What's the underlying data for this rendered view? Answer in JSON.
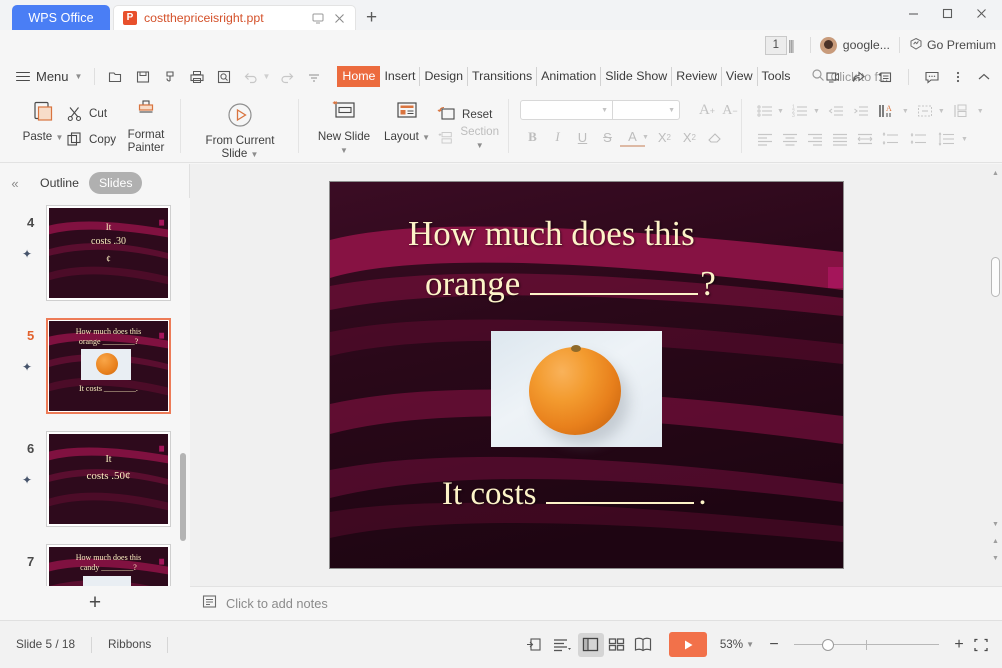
{
  "window": {
    "wps_button": "WPS Office",
    "document_tab": {
      "title": "costthepriceisright.ppt",
      "icon": "P",
      "present_icon": "monitor-icon",
      "close_icon": "close-icon"
    },
    "new_tab": "+",
    "minimize": "—",
    "maximize": "□",
    "close": "✕",
    "doc_count_badge": "1",
    "account_name": "google...",
    "premium_label": "Go Premium"
  },
  "menubar": {
    "menu_label": "Menu",
    "quick_access": [
      "open-icon",
      "save-icon",
      "save-as-icon",
      "print-icon",
      "print-preview-icon",
      "undo-icon",
      "redo-icon",
      "customize-icon"
    ],
    "tabs": [
      {
        "label": "Home",
        "active": true
      },
      {
        "label": "Insert",
        "active": false
      },
      {
        "label": "Design",
        "active": false
      },
      {
        "label": "Transitions",
        "active": false
      },
      {
        "label": "Animation",
        "active": false
      },
      {
        "label": "Slide Show",
        "active": false
      },
      {
        "label": "Review",
        "active": false
      },
      {
        "label": "View",
        "active": false
      },
      {
        "label": "Tools",
        "active": false
      }
    ],
    "search_placeholder": "Click to f...",
    "right_icons": [
      "screen-record-icon",
      "share-icon",
      "add-note-icon",
      "comment-icon",
      "more-icon",
      "collapse-ribbon-icon"
    ]
  },
  "ribbon": {
    "paste": "Paste",
    "cut": "Cut",
    "copy": "Copy",
    "format_painter": "Format Painter",
    "from_current_slide": "From Current Slide",
    "new_slide": "New Slide",
    "layout": "Layout",
    "reset": "Reset",
    "section": "Section",
    "font_name": "",
    "font_size": "",
    "font_buttons": [
      "bold",
      "italic",
      "underline",
      "strikethrough",
      "font-color",
      "superscript",
      "subscript",
      "clear-format"
    ],
    "grow_font": "A",
    "shrink_font": "A"
  },
  "panel": {
    "collapse_icon": "«",
    "tabs": [
      {
        "label": "Outline",
        "active": false
      },
      {
        "label": "Slides",
        "active": true
      }
    ],
    "add_slide": "+",
    "slides": [
      {
        "number": "4",
        "selected": false,
        "lines": [
          "It",
          "costs .30",
          "¢"
        ],
        "has_image": false
      },
      {
        "number": "5",
        "selected": true,
        "lines": [
          "How much does this",
          "orange ________?",
          "It costs ________."
        ],
        "has_image": true
      },
      {
        "number": "6",
        "selected": false,
        "lines": [
          "It",
          "costs .50¢"
        ],
        "has_image": false
      },
      {
        "number": "7",
        "selected": false,
        "lines": [
          "How much does this",
          "candy ________?"
        ],
        "has_image": true
      }
    ]
  },
  "slide": {
    "title_line1": "How much does this",
    "title_line2_prefix": "orange",
    "title_line2_suffix": "?",
    "body_prefix": "It costs",
    "body_suffix": ".",
    "image_alt": "orange-photo",
    "bg_color": "#2e0a1c",
    "accent_color": "#8e1347",
    "text_color": "#fdf3c8"
  },
  "notes": {
    "placeholder": "Click to add notes",
    "icon": "notes-icon"
  },
  "statusbar": {
    "slide_counter": "Slide 5 / 18",
    "mode": "Ribbons",
    "view_buttons": [
      "fit-slide-icon",
      "outline-view-icon",
      "normal-view-icon",
      "slide-sorter-icon",
      "reading-view-icon"
    ],
    "play_icon": "play-icon",
    "zoom_level": "53%",
    "zoom_out": "−",
    "zoom_in": "+",
    "fit_window": "fit-icon"
  }
}
